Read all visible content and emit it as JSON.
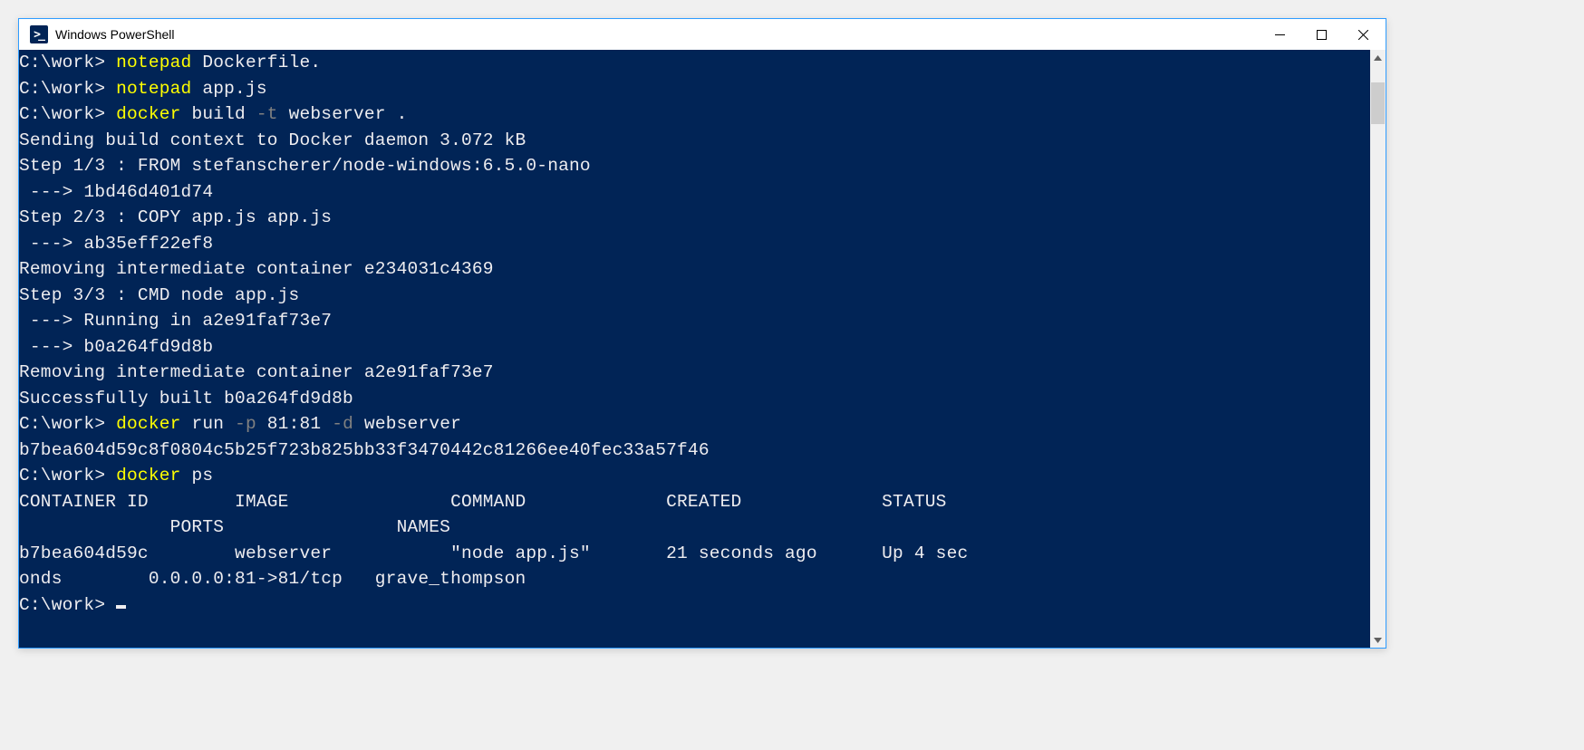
{
  "window": {
    "title": "Windows PowerShell"
  },
  "colors": {
    "terminal_bg": "#012456",
    "terminal_fg": "#eeedf0",
    "command_highlight": "#ffff00",
    "flag_gray": "#808080"
  },
  "prompt": "C:\\work>",
  "lines": [
    {
      "prompt": "C:\\work> ",
      "cmd": "notepad",
      "rest": " Dockerfile."
    },
    {
      "prompt": "C:\\work> ",
      "cmd": "notepad",
      "rest": " app.js"
    },
    {
      "prompt": "C:\\work> ",
      "cmd": "docker",
      "mid": " build ",
      "flag": "-t",
      "rest": " webserver ."
    },
    {
      "out": "Sending build context to Docker daemon 3.072 kB"
    },
    {
      "out": "Step 1/3 : FROM stefanscherer/node-windows:6.5.0-nano"
    },
    {
      "out": " ---> 1bd46d401d74"
    },
    {
      "out": "Step 2/3 : COPY app.js app.js"
    },
    {
      "out": " ---> ab35eff22ef8"
    },
    {
      "out": "Removing intermediate container e234031c4369"
    },
    {
      "out": "Step 3/3 : CMD node app.js"
    },
    {
      "out": " ---> Running in a2e91faf73e7"
    },
    {
      "out": " ---> b0a264fd9d8b"
    },
    {
      "out": "Removing intermediate container a2e91faf73e7"
    },
    {
      "out": "Successfully built b0a264fd9d8b"
    },
    {
      "prompt": "C:\\work> ",
      "cmd": "docker",
      "mid": " run ",
      "flag": "-p",
      "mid2": " 81:81 ",
      "flag2": "-d",
      "rest": " webserver"
    },
    {
      "out": "b7bea604d59c8f0804c5b25f723b825bb33f3470442c81266ee40fec33a57f46"
    },
    {
      "prompt": "C:\\work> ",
      "cmd": "docker",
      "rest": " ps"
    },
    {
      "out": "CONTAINER ID        IMAGE               COMMAND             CREATED             STATUS"
    },
    {
      "out": "              PORTS                NAMES"
    },
    {
      "out": "b7bea604d59c        webserver           \"node app.js\"       21 seconds ago      Up 4 sec"
    },
    {
      "out": "onds        0.0.0.0:81->81/tcp   grave_thompson"
    },
    {
      "prompt": "C:\\work> ",
      "cursor": true
    }
  ],
  "docker_ps": {
    "headers": [
      "CONTAINER ID",
      "IMAGE",
      "COMMAND",
      "CREATED",
      "STATUS",
      "PORTS",
      "NAMES"
    ],
    "rows": [
      {
        "container_id": "b7bea604d59c",
        "image": "webserver",
        "command": "\"node app.js\"",
        "created": "21 seconds ago",
        "status": "Up 4 seconds",
        "ports": "0.0.0.0:81->81/tcp",
        "names": "grave_thompson"
      }
    ]
  }
}
